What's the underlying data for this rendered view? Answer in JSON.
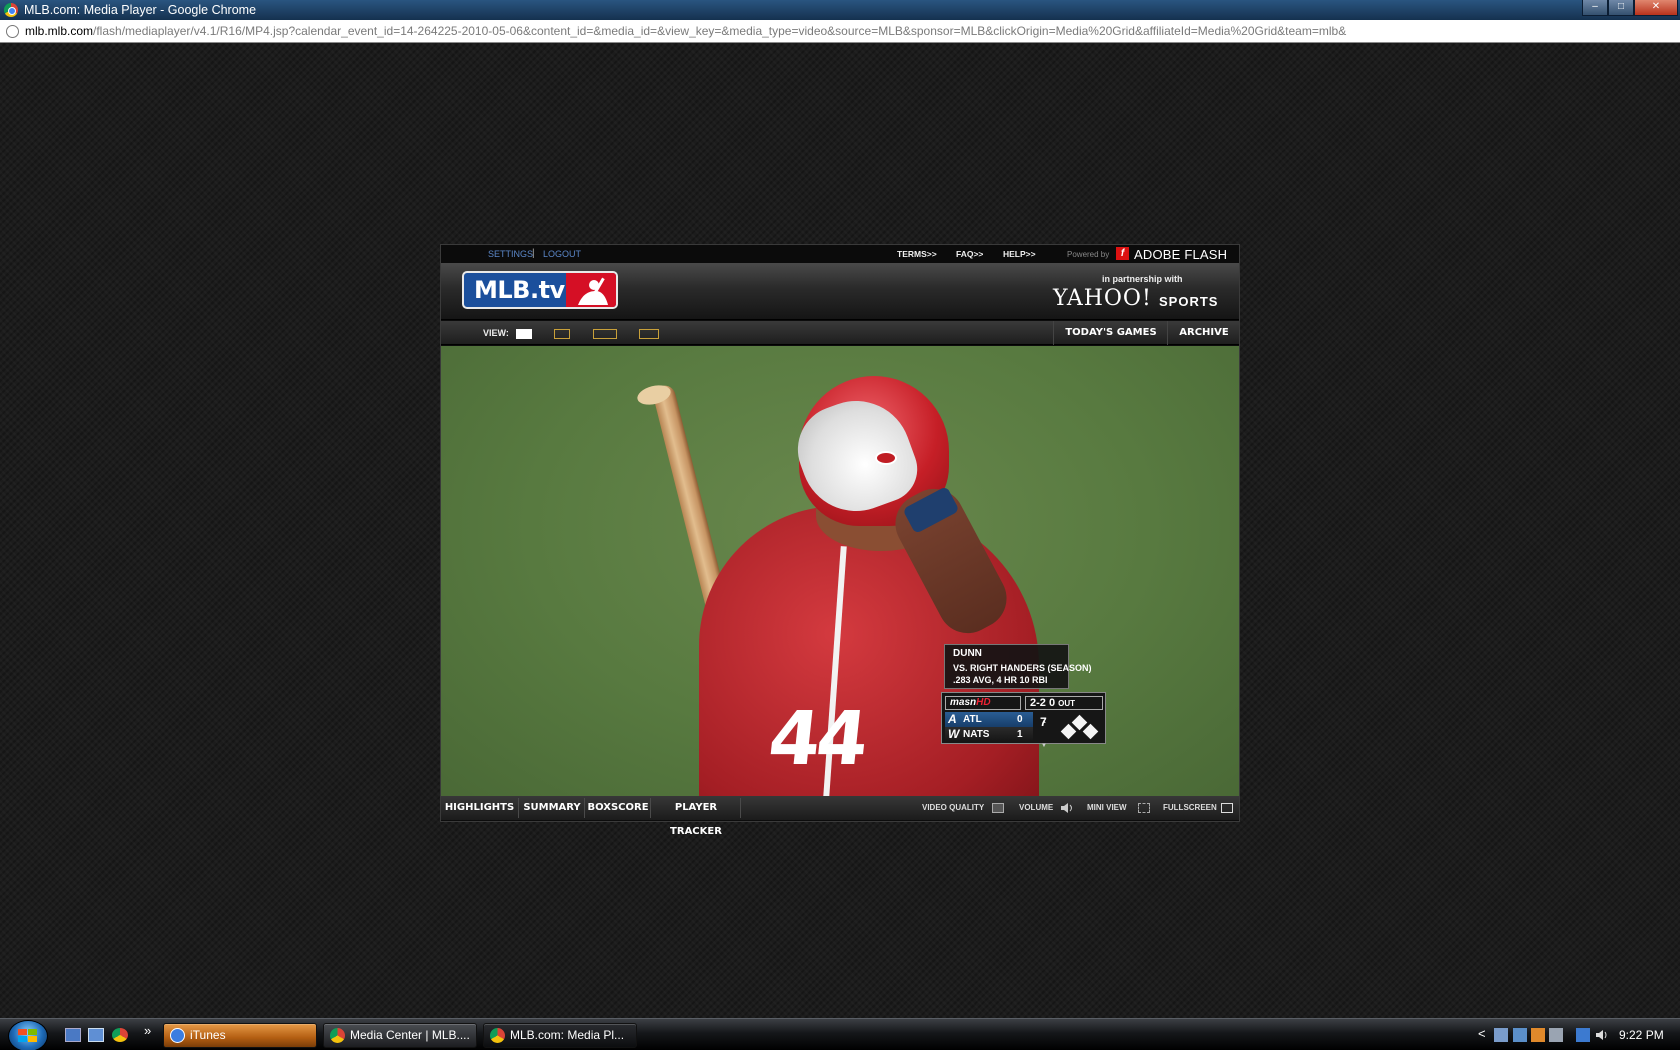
{
  "window": {
    "title": "MLB.com: Media Player - Google Chrome",
    "controls": {
      "minimize": "–",
      "maximize": "□",
      "close": "✕"
    }
  },
  "address": {
    "host": "mlb.mlb.com",
    "path": "/flash/mediaplayer/v4.1/R16/MP4.jsp?calendar_event_id=14-264225-2010-05-06&content_id=&media_id=&view_key=&media_type=video&source=MLB&sponsor=MLB&clickOrigin=Media%20Grid&affiliateId=Media%20Grid&team=mlb&"
  },
  "player": {
    "top_links": {
      "settings": "SETTINGS",
      "separator": "|",
      "logout": "LOGOUT",
      "terms": "TERMS>>",
      "faq": "FAQ>>",
      "help": "HELP>>"
    },
    "powered_by": "Powered by",
    "flash_label": "ADOBE FLASH",
    "logo_text": "MLB.tv",
    "partnership": "in partnership with",
    "yahoo": "YAHOO!",
    "sports": "SPORTS",
    "view_label": "VIEW:",
    "nav": {
      "todays_games": "TODAY'S GAMES",
      "archive": "ARCHIVE"
    },
    "overlay": {
      "batter": "DUNN",
      "stat_line_1": "VS. RIGHT HANDERS (SEASON)",
      "stat_line_2": ".283 AVG, 4 HR 10 RBI",
      "network": "masn",
      "network_hd": "HD",
      "count": "2-2 0",
      "out_label": "OUT",
      "jersey_number": "44",
      "teams": [
        {
          "logo": "A",
          "abbr": "ATL",
          "score": "0"
        },
        {
          "logo": "W",
          "abbr": "NATS",
          "score": "1"
        }
      ],
      "inning": "7"
    },
    "controls": {
      "highlights": "HIGHLIGHTS",
      "summary": "SUMMARY",
      "boxscore": "BOXSCORE",
      "player_tracker": "PLAYER TRACKER",
      "video_quality": "VIDEO QUALITY",
      "volume": "VOLUME",
      "mini_view": "MINI VIEW",
      "fullscreen": "FULLSCREEN"
    }
  },
  "taskbar": {
    "quick_launch_more": "»",
    "tasks": [
      {
        "label": "iTunes"
      },
      {
        "label": "Media Center | MLB...."
      },
      {
        "label": "MLB.com: Media Pl..."
      }
    ],
    "tray_chevron": "<",
    "clock": "9:22 PM"
  }
}
